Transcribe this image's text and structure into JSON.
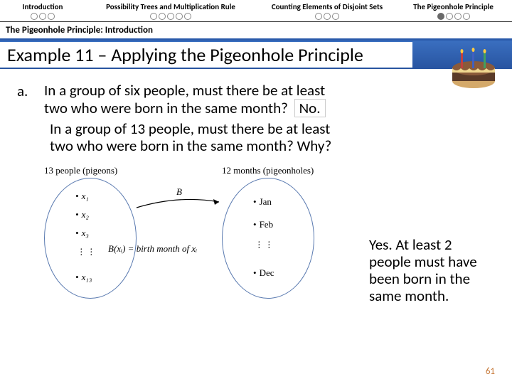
{
  "nav": [
    {
      "label": "Introduction",
      "dots": [
        0,
        0,
        0
      ]
    },
    {
      "label": "Possibility Trees and Multiplication Rule",
      "dots": [
        0,
        0,
        0,
        0,
        0
      ]
    },
    {
      "label": "Counting Elements of Disjoint Sets",
      "dots": [
        0,
        0,
        0
      ]
    },
    {
      "label": "The Pigeonhole Principle",
      "dots": [
        1,
        0,
        0,
        0
      ]
    }
  ],
  "subheading": "The Pigeonhole Principle: Introduction",
  "title": "Example 11 – Applying the Pigeonhole Principle",
  "question": {
    "label": "a.",
    "line1": "In a group of six people, must there be at least",
    "line2": "two who were born in the same month?",
    "ans1": "No.",
    "line3": "In a group of 13 people, must there be at least",
    "line4": "two who were born in the same month? Why?"
  },
  "diagram": {
    "leftLabel": "13 people (pigeons)",
    "rightLabel": "12 months (pigeonholes)",
    "leftItems": [
      "x₁",
      "x₂",
      "x₃",
      "x₁₃"
    ],
    "rightItems": [
      "Jan",
      "Feb",
      "Dec"
    ],
    "funcName": "B",
    "funcDef": "B(xᵢ) = birth month of xᵢ"
  },
  "answer": "Yes. At least 2 people must have been born in the same month.",
  "pageNumber": "61"
}
